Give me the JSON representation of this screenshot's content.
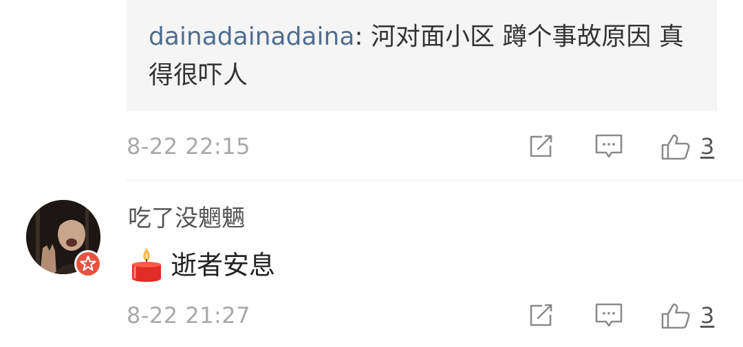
{
  "reply_quote": {
    "username": "dainadainadaina",
    "separator": ": ",
    "text": "河对面小区 蹲个事故原因 真得很吓人"
  },
  "comments": [
    {
      "timestamp": "8-22 22:15",
      "actions": {
        "repost_icon": "share-edit-icon",
        "comment_icon": "comment-icon",
        "like_icon": "thumbs-up-icon",
        "like_count": "3"
      }
    },
    {
      "username": "吃了没魍魉",
      "emoji": "candle-emoji",
      "text": "逝者安息",
      "timestamp": "8-22 21:27",
      "avatar_badge": "verified-badge-icon",
      "actions": {
        "repost_icon": "share-edit-icon",
        "comment_icon": "comment-icon",
        "like_icon": "thumbs-up-icon",
        "like_count": "3"
      }
    }
  ],
  "colors": {
    "username_blue": "#4f6d8f",
    "quote_bg": "#f5f5f5",
    "meta_gray": "#a8a8a8",
    "badge_red": "#e9523e"
  }
}
